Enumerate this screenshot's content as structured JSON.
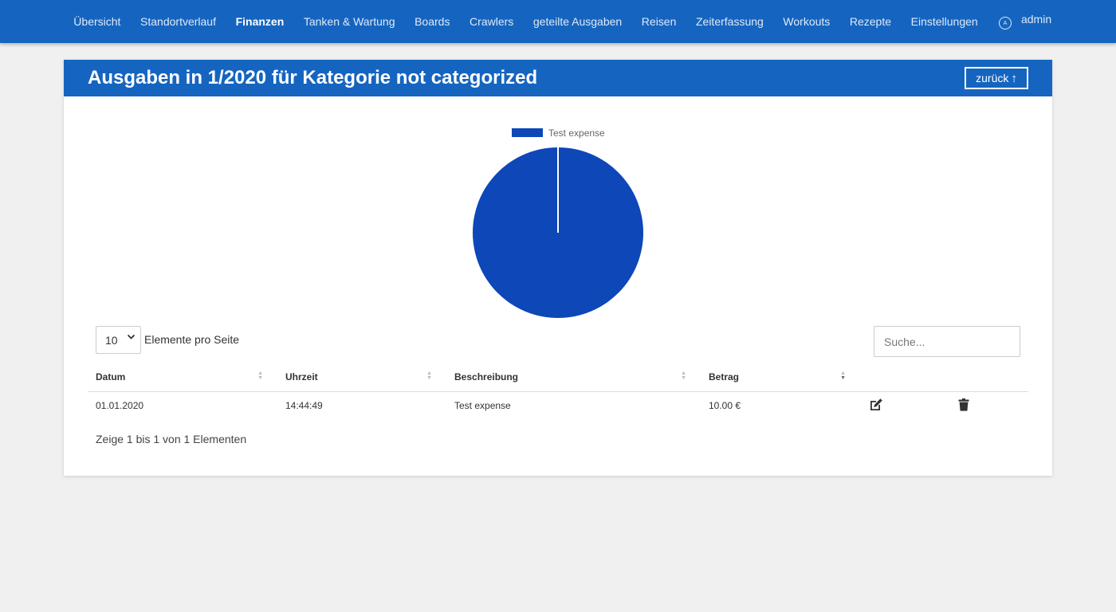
{
  "nav": {
    "items": [
      {
        "label": "Übersicht",
        "active": false
      },
      {
        "label": "Standortverlauf",
        "active": false
      },
      {
        "label": "Finanzen",
        "active": true
      },
      {
        "label": "Tanken & Wartung",
        "active": false
      },
      {
        "label": "Boards",
        "active": false
      },
      {
        "label": "Crawlers",
        "active": false
      },
      {
        "label": "geteilte Ausgaben",
        "active": false
      },
      {
        "label": "Reisen",
        "active": false
      },
      {
        "label": "Zeiterfassung",
        "active": false
      },
      {
        "label": "Workouts",
        "active": false
      },
      {
        "label": "Rezepte",
        "active": false
      },
      {
        "label": "Einstellungen",
        "active": false
      }
    ],
    "user": {
      "avatar_letter": "A",
      "name": "admin",
      "icon": "avatar-icon"
    }
  },
  "header": {
    "title": "Ausgaben in 1/2020 für Kategorie not categorized",
    "back_label": "zurück",
    "back_icon": "arrow-up-icon"
  },
  "chart_data": {
    "type": "pie",
    "categories": [
      "Test expense"
    ],
    "values": [
      10.0
    ],
    "colors": [
      "#0d47b8"
    ],
    "legend_position": "top"
  },
  "table_controls": {
    "page_size": "10",
    "page_size_label": "Elemente pro Seite",
    "search_placeholder": "Suche..."
  },
  "table": {
    "columns": [
      "Datum",
      "Uhrzeit",
      "Beschreibung",
      "Betrag"
    ],
    "rows": [
      {
        "date": "01.01.2020",
        "time": "14:44:49",
        "description": "Test expense",
        "amount": "10.00 €"
      }
    ],
    "info": "Zeige 1 bis 1 von 1 Elementen"
  },
  "colors": {
    "primary": "#1565c0",
    "chart": "#0d47b8",
    "background": "#f0f0f0"
  }
}
